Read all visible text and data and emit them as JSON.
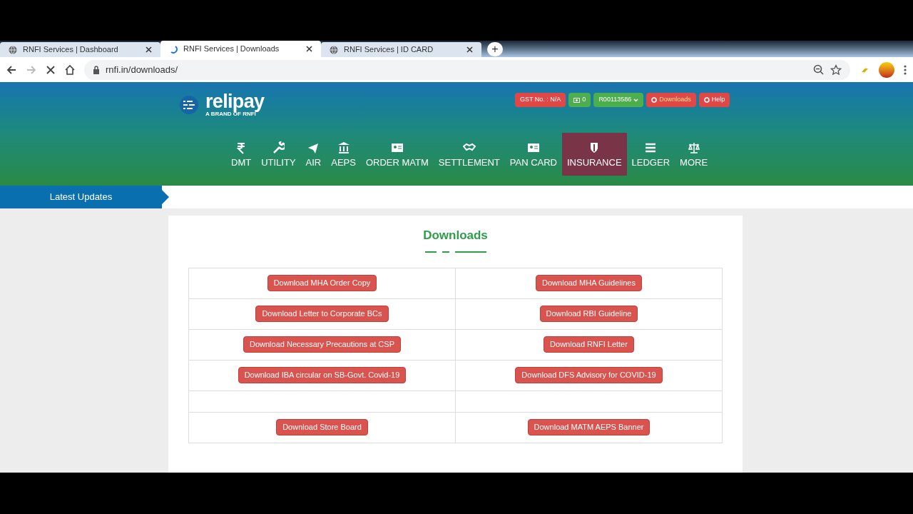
{
  "browser_tabs": [
    {
      "title": "RNFI Services | Dashboard",
      "selected": false
    },
    {
      "title": "RNFI Services | Downloads",
      "selected": true
    },
    {
      "title": "RNFI Services | ID CARD",
      "selected": false
    }
  ],
  "new_tab": "+",
  "address": "rnfi.in/downloads/",
  "logo": {
    "name": "relipay",
    "tagline": "A BRAND OF RNFI"
  },
  "top_buttons": [
    {
      "kind": "gst",
      "label": "GST No. : N/A"
    },
    {
      "kind": "wallet",
      "label": "0"
    },
    {
      "kind": "account",
      "label": "R00113586"
    },
    {
      "kind": "downloads",
      "label": "Downloads"
    },
    {
      "kind": "help",
      "label": "Help"
    }
  ],
  "nav": [
    {
      "label": "DMT",
      "selected": false
    },
    {
      "label": "UTILITY",
      "selected": false
    },
    {
      "label": "AIR",
      "selected": false
    },
    {
      "label": "AEPS",
      "selected": false
    },
    {
      "label": "ORDER MATM",
      "selected": false
    },
    {
      "label": "SETTLEMENT",
      "selected": false
    },
    {
      "label": "PAN CARD",
      "selected": false
    },
    {
      "label": "INSURANCE",
      "selected": true
    },
    {
      "label": "LEDGER",
      "selected": false
    },
    {
      "label": "MORE",
      "selected": false
    }
  ],
  "latest_updates": "Latest Updates",
  "title": "Downloads",
  "rows": [
    {
      "kind": "links",
      "links": [
        "Download MHA Order Copy",
        "Download MHA Guidelines"
      ]
    },
    {
      "kind": "links",
      "links": [
        "Download Letter to Corporate BCs",
        "Download RBI Guideline"
      ]
    },
    {
      "kind": "links",
      "links": [
        "Download Necessary Precautions at CSP",
        "Download RNFI Letter"
      ]
    },
    {
      "kind": "links",
      "links": [
        "Download IBA circular on SB-Govt. Covid-19",
        "Download DFS Advisory for COVID-19"
      ]
    },
    {
      "kind": "blank"
    },
    {
      "kind": "links",
      "links": [
        "Download Store Board",
        "Download MATM AEPS Banner"
      ]
    }
  ]
}
